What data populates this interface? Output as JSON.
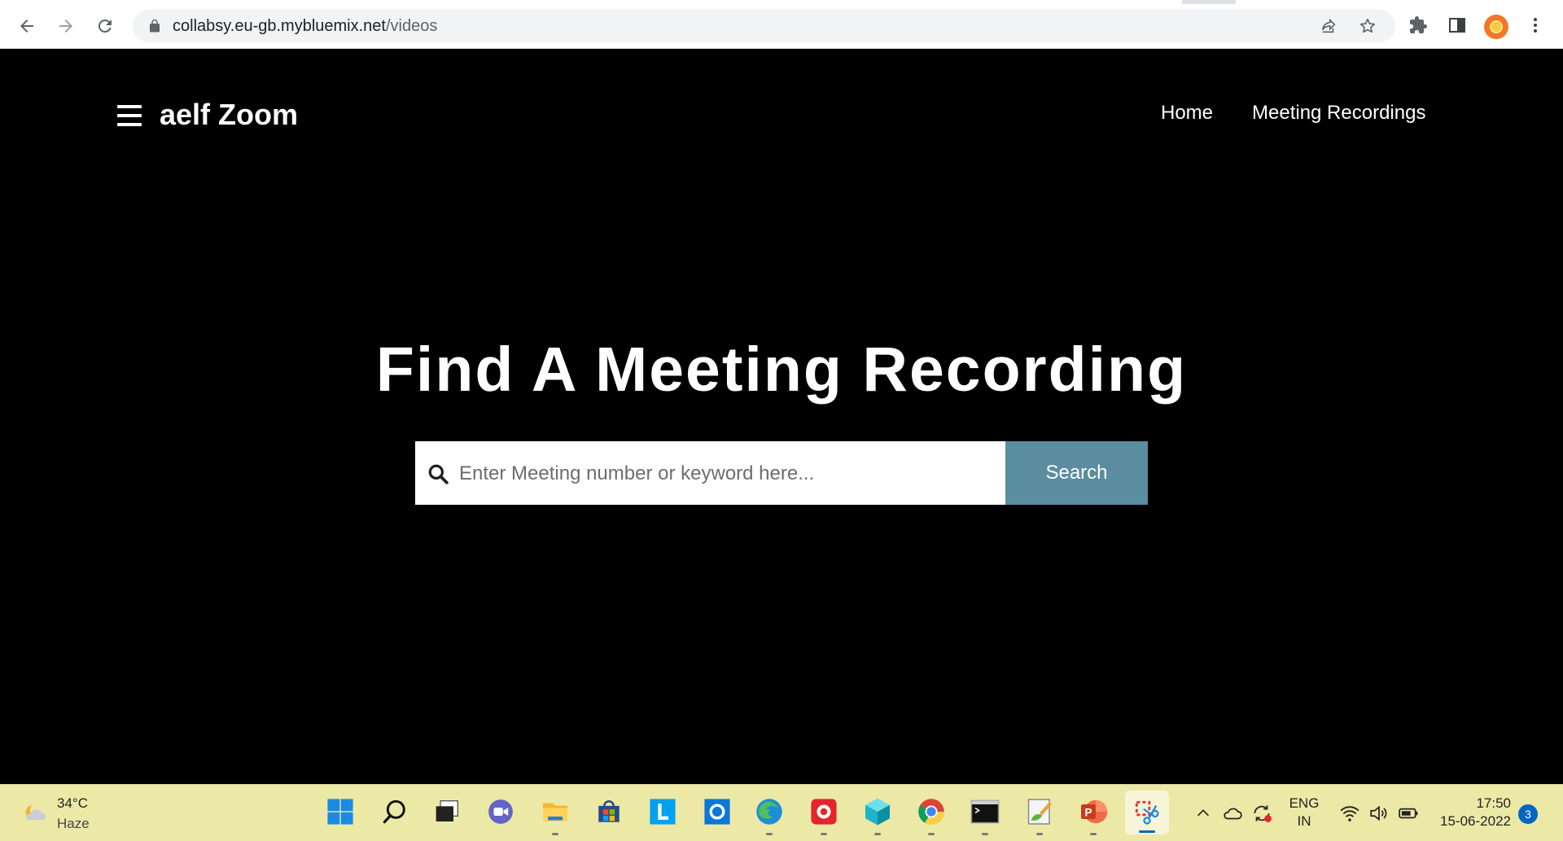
{
  "browser": {
    "url_domain": "collabsy.eu-gb.mybluemix.net",
    "url_path": "/videos",
    "icons": [
      "back-icon",
      "forward-icon",
      "reload-icon",
      "lock-icon",
      "share-icon",
      "star-icon",
      "extensions-icon",
      "side-panel-icon",
      "profile-avatar",
      "more-icon"
    ]
  },
  "site": {
    "brand": "aelf Zoom",
    "nav": [
      {
        "label": "Home"
      },
      {
        "label": "Meeting Recordings"
      }
    ],
    "hero_title": "Find A Meeting Recording",
    "search": {
      "placeholder": "Enter Meeting number or keyword here...",
      "value": "",
      "button_label": "Search"
    },
    "colors": {
      "background": "#000000",
      "search_button": "#5a8da0"
    }
  },
  "taskbar": {
    "weather": {
      "temp": "34°C",
      "desc": "Haze"
    },
    "apps": [
      "start",
      "search",
      "task-view",
      "teams-chat",
      "file-explorer",
      "store",
      "l-app",
      "cortana",
      "edge",
      "red-app",
      "cube-app",
      "chrome",
      "terminal",
      "paint",
      "powerpoint",
      "snipping-tool"
    ],
    "lang": {
      "line1": "ENG",
      "line2": "IN"
    },
    "clock": {
      "time": "17:50",
      "date": "15-06-2022"
    },
    "notifications": "3"
  }
}
